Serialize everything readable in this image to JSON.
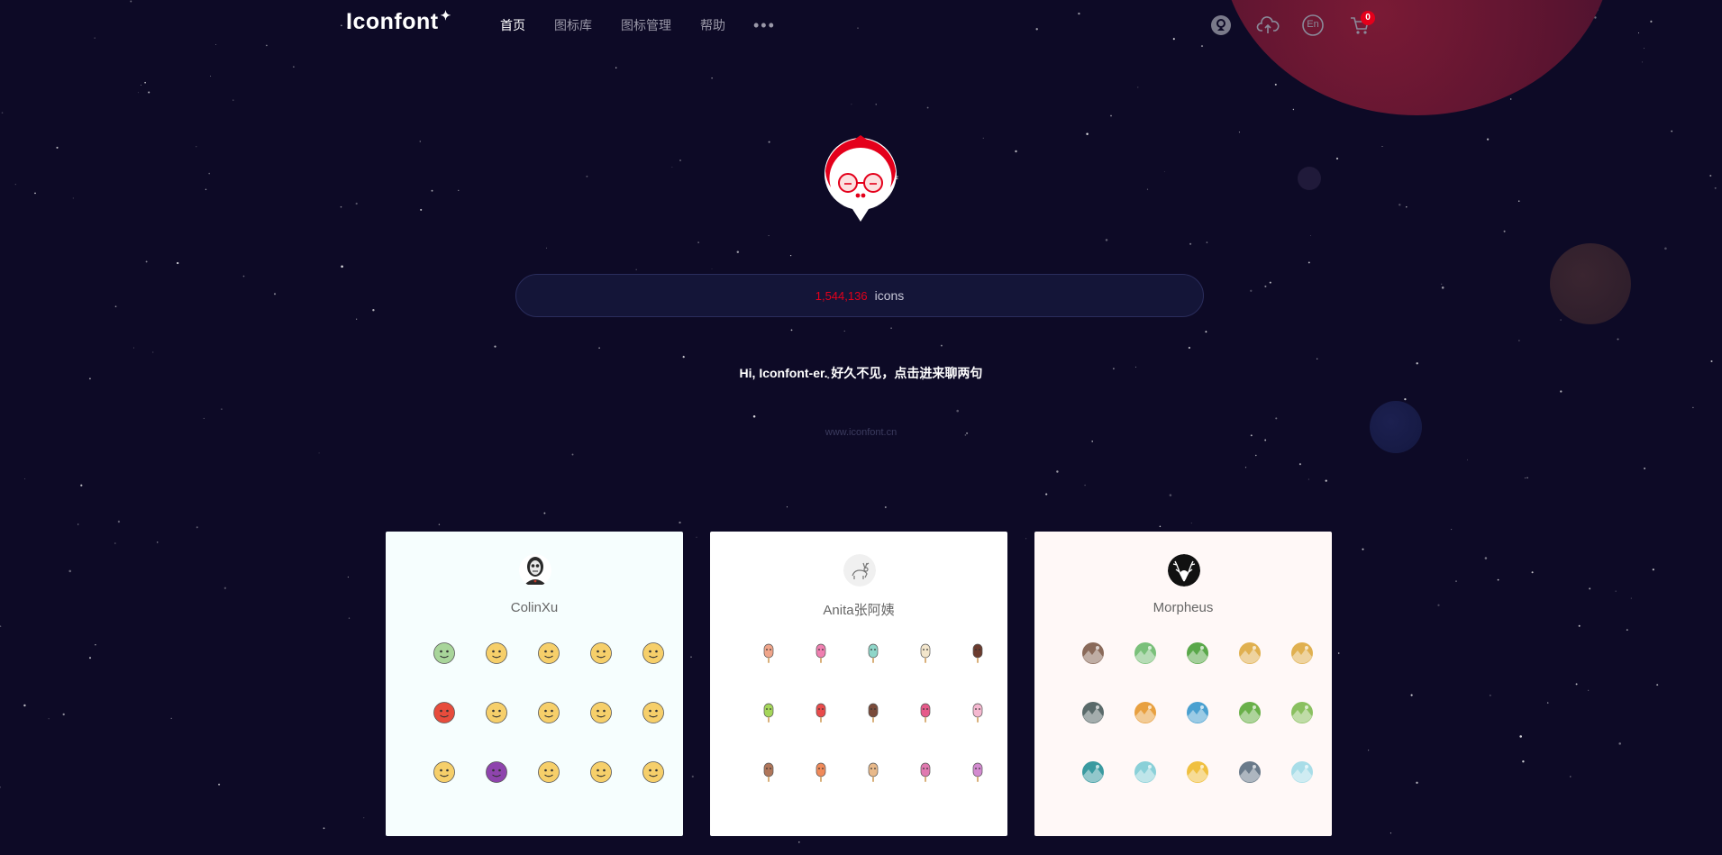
{
  "header": {
    "logo": "Iconfont",
    "nav": [
      {
        "label": "首页",
        "active": true
      },
      {
        "label": "图标库",
        "active": false
      },
      {
        "label": "图标管理",
        "active": false
      },
      {
        "label": "帮助",
        "active": false
      }
    ],
    "more": "•••",
    "icons": [
      "community-icon",
      "upload-icon",
      "language-en-icon",
      "cart-icon"
    ],
    "lang_label": "En",
    "cart_count": "0"
  },
  "search": {
    "count": "1,544,136",
    "unit": "icons"
  },
  "greeting": "Hi, Iconfont-er. 好久不见，点击进来聊两句",
  "site_url": "www.iconfont.cn",
  "cards": [
    {
      "name": "ColinXu",
      "background": "#f6fefe",
      "avatar_icon": "skull-avatar-icon",
      "icons": [
        {
          "name": "sick-face-icon",
          "color": "#a8d59a"
        },
        {
          "name": "angel-face-icon",
          "color": "#f6cf6a"
        },
        {
          "name": "tongue-out-face-icon",
          "color": "#f6cf6a"
        },
        {
          "name": "sunglasses-face-icon",
          "color": "#f6cf6a"
        },
        {
          "name": "wink-face-icon",
          "color": "#f6cf6a"
        },
        {
          "name": "angry-face-icon",
          "color": "#e74c3c"
        },
        {
          "name": "cool-face-icon",
          "color": "#f6cf6a"
        },
        {
          "name": "shocked-face-icon",
          "color": "#f6cf6a"
        },
        {
          "name": "crying-face-icon",
          "color": "#f6cf6a"
        },
        {
          "name": "kiss-face-icon",
          "color": "#f6cf6a"
        },
        {
          "name": "neutral-face-icon",
          "color": "#f6cf6a"
        },
        {
          "name": "devil-face-icon",
          "color": "#8e44ad"
        },
        {
          "name": "dizzy-face-icon",
          "color": "#f6cf6a"
        },
        {
          "name": "smile-face-icon",
          "color": "#f6cf6a"
        },
        {
          "name": "grin-face-icon",
          "color": "#f6cf6a"
        }
      ]
    },
    {
      "name": "Anita张阿姨",
      "background": "#ffffff",
      "avatar_icon": "deer-avatar-icon",
      "icons": [
        {
          "name": "popsicle-peach-icon",
          "color": "#f0a58a"
        },
        {
          "name": "popsicle-pink-icon",
          "color": "#ef7fb0"
        },
        {
          "name": "ice-cream-cone-mint-icon",
          "color": "#8fd6c9"
        },
        {
          "name": "popsicle-vanilla-icon",
          "color": "#f3e6cc"
        },
        {
          "name": "popsicle-chocolate-icon",
          "color": "#6b3b2e"
        },
        {
          "name": "popsicle-lime-icon",
          "color": "#a5d65a"
        },
        {
          "name": "watermelon-popsicle-icon",
          "color": "#e94b4b"
        },
        {
          "name": "popsicle-brown-icon",
          "color": "#7a4b3a"
        },
        {
          "name": "popsicle-raspberry-icon",
          "color": "#e65a8a"
        },
        {
          "name": "popsicle-light-pink-icon",
          "color": "#f5b8d0"
        },
        {
          "name": "bear-ice-cream-icon",
          "color": "#b0765a"
        },
        {
          "name": "popsicle-orange-icon",
          "color": "#f08a5a"
        },
        {
          "name": "ice-cream-cone-icon",
          "color": "#e8b98a"
        },
        {
          "name": "candy-stick-icon",
          "color": "#e07ab0"
        },
        {
          "name": "popsicle-lilac-icon",
          "color": "#d38ad0"
        }
      ]
    },
    {
      "name": "Morpheus",
      "background": "#fff8f7",
      "avatar_icon": "stag-avatar-icon",
      "icons": [
        {
          "name": "mountain-landscape-icon",
          "color": "#8a6a5a"
        },
        {
          "name": "waterfall-landscape-icon",
          "color": "#7ac07a"
        },
        {
          "name": "forest-landscape-icon",
          "color": "#5aa84a"
        },
        {
          "name": "desert-landscape-icon",
          "color": "#e0b050"
        },
        {
          "name": "sunset-landscape-icon",
          "color": "#e0b050"
        },
        {
          "name": "earth-landscape-icon",
          "color": "#5a6a6a"
        },
        {
          "name": "city-landscape-icon",
          "color": "#e8a040"
        },
        {
          "name": "river-landscape-icon",
          "color": "#4aa0d0"
        },
        {
          "name": "hill-landscape-icon",
          "color": "#6ab04a"
        },
        {
          "name": "field-landscape-icon",
          "color": "#8ac060"
        },
        {
          "name": "deer-landscape-icon",
          "color": "#3a9aa0"
        },
        {
          "name": "lake-landscape-icon",
          "color": "#8ad0d8"
        },
        {
          "name": "beach-landscape-icon",
          "color": "#f0c040"
        },
        {
          "name": "snow-mountain-landscape-icon",
          "color": "#6a7a8a"
        },
        {
          "name": "sky-landscape-icon",
          "color": "#a8dde8"
        }
      ]
    }
  ]
}
